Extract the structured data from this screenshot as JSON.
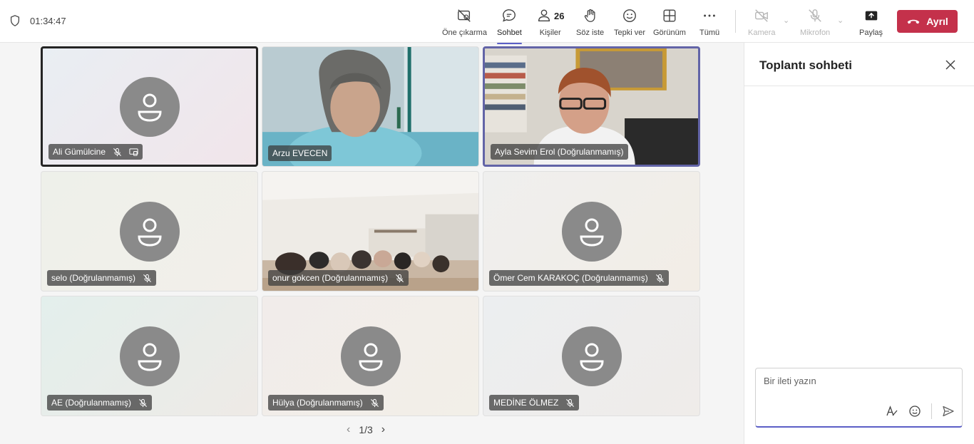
{
  "call": {
    "duration": "01:34:47"
  },
  "toolbar": {
    "spotlight": "Öne çıkarma",
    "chat": "Sohbet",
    "people": "Kişiler",
    "people_count": "26",
    "raise_hand": "Söz iste",
    "react": "Tepki ver",
    "view": "Görünüm",
    "more": "Tümü",
    "camera": "Kamera",
    "mic": "Mikrofon",
    "share": "Paylaş",
    "leave": "Ayrıl"
  },
  "participants": [
    {
      "name": "Ali Gümülcine",
      "video": false
    },
    {
      "name": "Arzu EVECEN",
      "video": true
    },
    {
      "name": "Ayla Sevim Erol (Doğrulanmamış)",
      "video": true
    },
    {
      "name": "selo (Doğrulanmamış)",
      "video": false
    },
    {
      "name": "onur gokcen (Doğrulanmamış)",
      "video": true
    },
    {
      "name": "Ömer Cem KARAKOÇ (Doğrulanmamış)",
      "video": false
    },
    {
      "name": "AE (Doğrulanmamış)",
      "video": false
    },
    {
      "name": "Hülya (Doğrulanmamış)",
      "video": false
    },
    {
      "name": "MEDİNE ÖLMEZ",
      "video": false
    }
  ],
  "pagination": {
    "label": "1/3"
  },
  "chat": {
    "title": "Toplantı sohbeti",
    "placeholder": "Bir ileti yazın"
  },
  "colors": {
    "accent": "#5b5fc7",
    "leave": "#c4314b",
    "avatar": "#8a8a8a"
  }
}
